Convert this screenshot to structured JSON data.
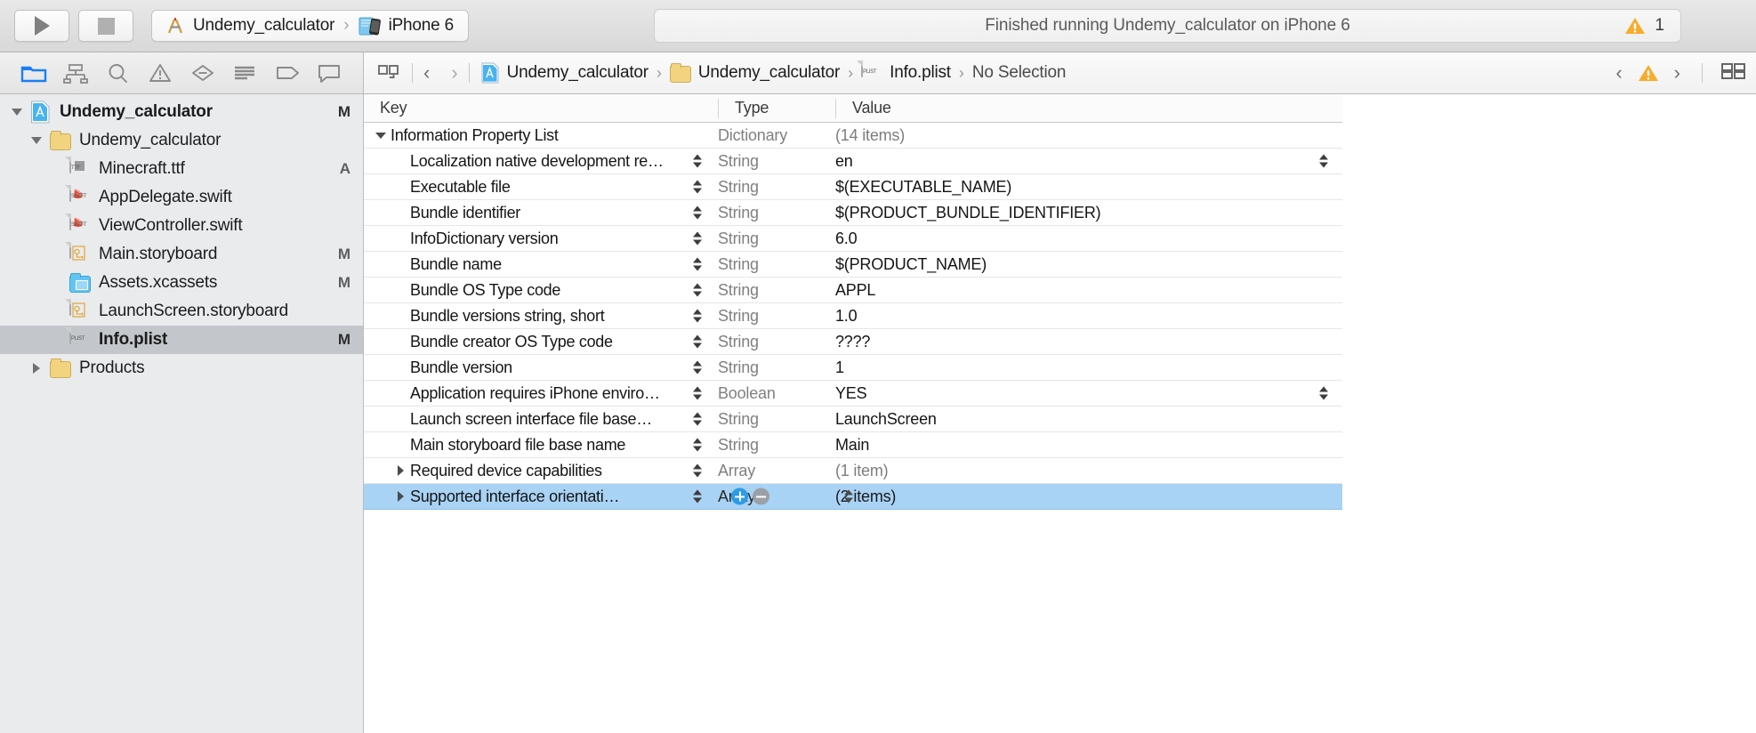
{
  "toolbar": {
    "run_icon": "play-triangle-icon",
    "stop_icon": "stop-square-icon",
    "scheme_icon": "xcode-scheme-icon",
    "scheme_name": "Undemy_calculator",
    "destination_icon": "iphone-simulator-icon",
    "destination_name": "iPhone 6",
    "breadcrumb_separator": "›",
    "status_message": "Finished running Undemy_calculator on iPhone 6",
    "warning_icon": "warning-triangle-icon",
    "warning_count": "1",
    "warning_color": "#f6ac2e"
  },
  "navigator_tabs": [
    {
      "name": "project-navigator",
      "icon": "folder-icon",
      "active": true
    },
    {
      "name": "source-control-navigator",
      "icon": "source-control-icon",
      "active": false
    },
    {
      "name": "find-navigator",
      "icon": "magnifier-icon",
      "active": false
    },
    {
      "name": "issue-navigator",
      "icon": "warning-triangle-icon",
      "active": false
    },
    {
      "name": "test-navigator",
      "icon": "diamond-minus-icon",
      "active": false
    },
    {
      "name": "debug-navigator",
      "icon": "debug-lines-icon",
      "active": false
    },
    {
      "name": "breakpoint-navigator",
      "icon": "breakpoint-tag-icon",
      "active": false
    },
    {
      "name": "report-navigator",
      "icon": "speech-bubble-icon",
      "active": false
    }
  ],
  "jump_bar": {
    "related_files_icon": "related-items-icon",
    "back_icon": "chevron-left-icon",
    "forward_icon": "chevron-right-icon",
    "crumbs": [
      {
        "label": "Undemy_calculator",
        "icon": "xcode-project-icon"
      },
      {
        "label": "Undemy_calculator",
        "icon": "folder-icon"
      },
      {
        "label": "Info.plist",
        "icon": "plist-file-icon"
      },
      {
        "label": "No Selection",
        "icon": ""
      }
    ],
    "separator": "›",
    "right_back_icon": "chevron-left-icon",
    "right_warning_icon": "warning-triangle-icon",
    "right_forward_icon": "chevron-right-icon",
    "assistant_icon": "assistant-editor-icon"
  },
  "sidebar": {
    "items": [
      {
        "label": "Undemy_calculator",
        "icon": "xcode-project-icon",
        "indent": 0,
        "disclosure": "down",
        "status": "M",
        "bold": true,
        "selected": false
      },
      {
        "label": "Undemy_calculator",
        "icon": "folder-icon",
        "indent": 1,
        "disclosure": "down",
        "status": "",
        "bold": false,
        "selected": false
      },
      {
        "label": "Minecraft.ttf",
        "icon": "ttf-file-icon",
        "indent": 2,
        "disclosure": "none",
        "status": "A",
        "bold": false,
        "selected": false
      },
      {
        "label": "AppDelegate.swift",
        "icon": "swift-file-icon",
        "indent": 2,
        "disclosure": "none",
        "status": "",
        "bold": false,
        "selected": false
      },
      {
        "label": "ViewController.swift",
        "icon": "swift-file-icon",
        "indent": 2,
        "disclosure": "none",
        "status": "",
        "bold": false,
        "selected": false
      },
      {
        "label": "Main.storyboard",
        "icon": "storyboard-file-icon",
        "indent": 2,
        "disclosure": "none",
        "status": "M",
        "bold": false,
        "selected": false
      },
      {
        "label": "Assets.xcassets",
        "icon": "xcassets-folder-icon",
        "indent": 2,
        "disclosure": "none",
        "status": "M",
        "bold": false,
        "selected": false
      },
      {
        "label": "LaunchScreen.storyboard",
        "icon": "storyboard-file-icon",
        "indent": 2,
        "disclosure": "none",
        "status": "",
        "bold": false,
        "selected": false
      },
      {
        "label": "Info.plist",
        "icon": "plist-file-icon",
        "indent": 2,
        "disclosure": "none",
        "status": "M",
        "bold": true,
        "selected": true
      },
      {
        "label": "Products",
        "icon": "folder-icon",
        "indent": 1,
        "disclosure": "right",
        "status": "",
        "bold": false,
        "selected": false
      }
    ]
  },
  "plist": {
    "columns": {
      "key": "Key",
      "type": "Type",
      "value": "Value"
    },
    "rows": [
      {
        "key": "Information Property List",
        "type": "Dictionary",
        "value": "(14 items)",
        "indent": 0,
        "disclosure": "down",
        "stepper": false,
        "value_dim": true,
        "value_stepper": false,
        "selected": false
      },
      {
        "key": "Localization native development re…",
        "type": "String",
        "value": "en",
        "indent": 1,
        "disclosure": "none",
        "stepper": true,
        "value_dim": false,
        "value_stepper": true,
        "selected": false
      },
      {
        "key": "Executable file",
        "type": "String",
        "value": "$(EXECUTABLE_NAME)",
        "indent": 1,
        "disclosure": "none",
        "stepper": true,
        "value_dim": false,
        "value_stepper": false,
        "selected": false
      },
      {
        "key": "Bundle identifier",
        "type": "String",
        "value": "$(PRODUCT_BUNDLE_IDENTIFIER)",
        "indent": 1,
        "disclosure": "none",
        "stepper": true,
        "value_dim": false,
        "value_stepper": false,
        "selected": false
      },
      {
        "key": "InfoDictionary version",
        "type": "String",
        "value": "6.0",
        "indent": 1,
        "disclosure": "none",
        "stepper": true,
        "value_dim": false,
        "value_stepper": false,
        "selected": false
      },
      {
        "key": "Bundle name",
        "type": "String",
        "value": "$(PRODUCT_NAME)",
        "indent": 1,
        "disclosure": "none",
        "stepper": true,
        "value_dim": false,
        "value_stepper": false,
        "selected": false
      },
      {
        "key": "Bundle OS Type code",
        "type": "String",
        "value": "APPL",
        "indent": 1,
        "disclosure": "none",
        "stepper": true,
        "value_dim": false,
        "value_stepper": false,
        "selected": false
      },
      {
        "key": "Bundle versions string, short",
        "type": "String",
        "value": "1.0",
        "indent": 1,
        "disclosure": "none",
        "stepper": true,
        "value_dim": false,
        "value_stepper": false,
        "selected": false
      },
      {
        "key": "Bundle creator OS Type code",
        "type": "String",
        "value": "????",
        "indent": 1,
        "disclosure": "none",
        "stepper": true,
        "value_dim": false,
        "value_stepper": false,
        "selected": false
      },
      {
        "key": "Bundle version",
        "type": "String",
        "value": "1",
        "indent": 1,
        "disclosure": "none",
        "stepper": true,
        "value_dim": false,
        "value_stepper": false,
        "selected": false
      },
      {
        "key": "Application requires iPhone enviro…",
        "type": "Boolean",
        "value": "YES",
        "indent": 1,
        "disclosure": "none",
        "stepper": true,
        "value_dim": false,
        "value_stepper": true,
        "selected": false
      },
      {
        "key": "Launch screen interface file base…",
        "type": "String",
        "value": "LaunchScreen",
        "indent": 1,
        "disclosure": "none",
        "stepper": true,
        "value_dim": false,
        "value_stepper": false,
        "selected": false
      },
      {
        "key": "Main storyboard file base name",
        "type": "String",
        "value": "Main",
        "indent": 1,
        "disclosure": "none",
        "stepper": true,
        "value_dim": false,
        "value_stepper": false,
        "selected": false
      },
      {
        "key": "Required device capabilities",
        "type": "Array",
        "value": "(1 item)",
        "indent": 1,
        "disclosure": "right",
        "stepper": true,
        "value_dim": true,
        "value_stepper": false,
        "selected": false
      },
      {
        "key": "Supported interface orientati…",
        "type": "Array",
        "value": "(2 items)",
        "indent": 1,
        "disclosure": "right",
        "stepper": true,
        "value_dim": false,
        "value_stepper": false,
        "selected": true
      }
    ],
    "add_icon": "add-row-plus-icon",
    "remove_icon": "remove-row-minus-icon",
    "selection_color": "#a9d3f5"
  }
}
